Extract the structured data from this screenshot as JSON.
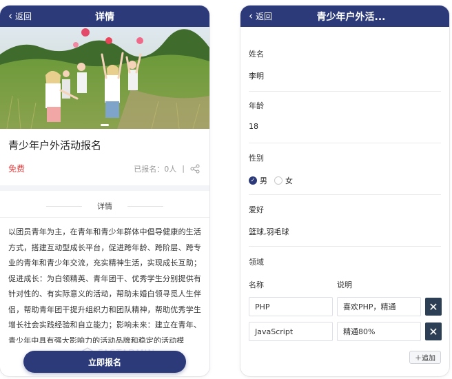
{
  "left": {
    "header": {
      "back_label": "返回",
      "title": "详情"
    },
    "event": {
      "title": "青少年户外活动报名",
      "price": "免费",
      "signup_count": "已报名：0人",
      "separator": "|"
    },
    "section": {
      "title": "详情"
    },
    "detail_text": "以团员青年为主，在青年和青少年群体中倡导健康的生活方式，搭建互动型成长平台，促进跨年龄、跨阶层、跨专业的青年和青少年交流，充实精神生活，实现成长互助；促进成长：为白领精英、青年团干、优秀学生分别提供有针对性的、有实际意义的活动，帮助未婚白领寻觅人生伴侣，帮助青年团干提升组织力和团队精神，帮助优秀学生增长社会实践经验和自立能力；影响未来：建立在青年、青少年中具有强大影响力的活动品牌和稳定的活动模",
    "watermark": "FASTADMIN",
    "cta_label": "立即报名"
  },
  "right": {
    "header": {
      "back_label": "返回",
      "title": "青少年户外活..."
    },
    "fields": {
      "name": {
        "label": "姓名",
        "value": "李明"
      },
      "age": {
        "label": "年龄",
        "value": "18"
      },
      "gender": {
        "label": "性别",
        "options": [
          "男",
          "女"
        ],
        "selected": "男"
      },
      "hobby": {
        "label": "爱好",
        "value": "篮球,羽毛球"
      },
      "domain": {
        "label": "领域",
        "col_name": "名称",
        "col_desc": "说明",
        "rows": [
          {
            "name": "PHP",
            "desc": "喜欢PHP，精通"
          },
          {
            "name": "JavaScript",
            "desc": "精通80%"
          }
        ],
        "delete_glyph": "✕",
        "add_label": "＋追加"
      }
    }
  },
  "colors": {
    "primary": "#2c3a7a",
    "price": "#e23b3b",
    "delete_button": "#2d3f55"
  },
  "icons": [
    "chevron-left-icon",
    "share-icon",
    "checkmark-icon",
    "close-icon",
    "plus-icon"
  ]
}
